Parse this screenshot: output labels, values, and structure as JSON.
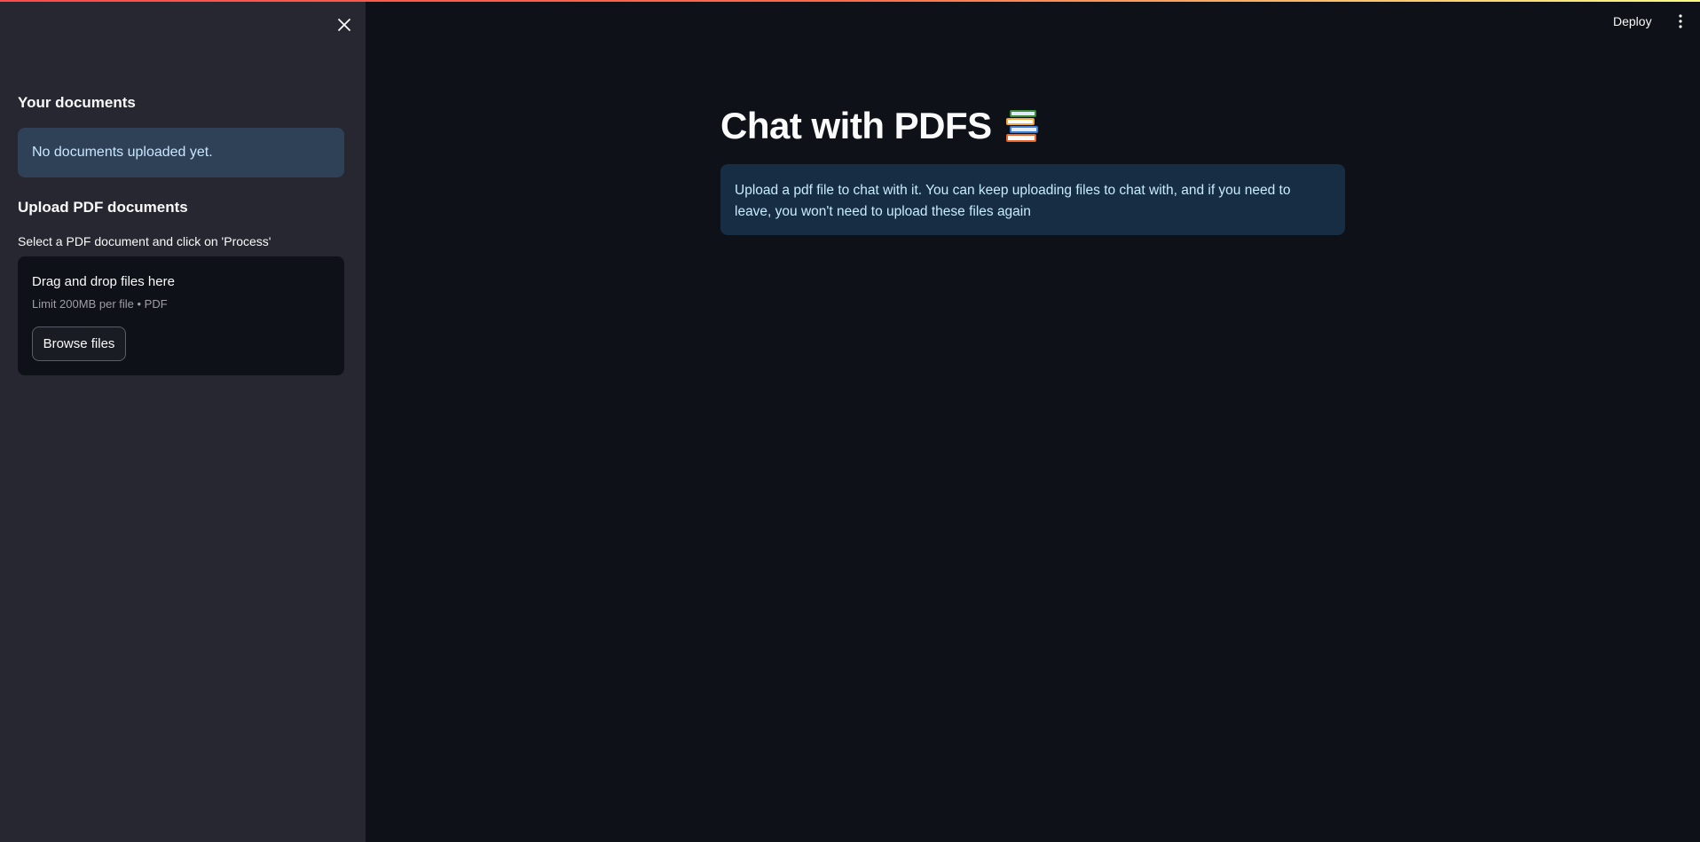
{
  "sidebar": {
    "close_icon": "close-icon",
    "documents_title": "Your documents",
    "documents_status": "No documents uploaded yet.",
    "upload_title": "Upload PDF documents",
    "upload_caption": "Select a PDF document and click on 'Process'",
    "dropzone": {
      "title": "Drag and drop files here",
      "limit": "Limit 200MB per file • PDF",
      "browse_label": "Browse files"
    }
  },
  "header": {
    "deploy_label": "Deploy",
    "menu_icon": "kebab-menu-icon"
  },
  "main": {
    "title": "Chat with PDFS",
    "title_icon": "books-icon",
    "info_text": "Upload a pdf file to chat with it. You can keep uploading files to chat with, and if you need to leave, you won't need to upload these files again"
  },
  "colors": {
    "background": "#0e1117",
    "sidebar": "#262730",
    "accent": "#ff4b4b",
    "info_box": "#2f4157",
    "main_info_box": "#172d43"
  }
}
